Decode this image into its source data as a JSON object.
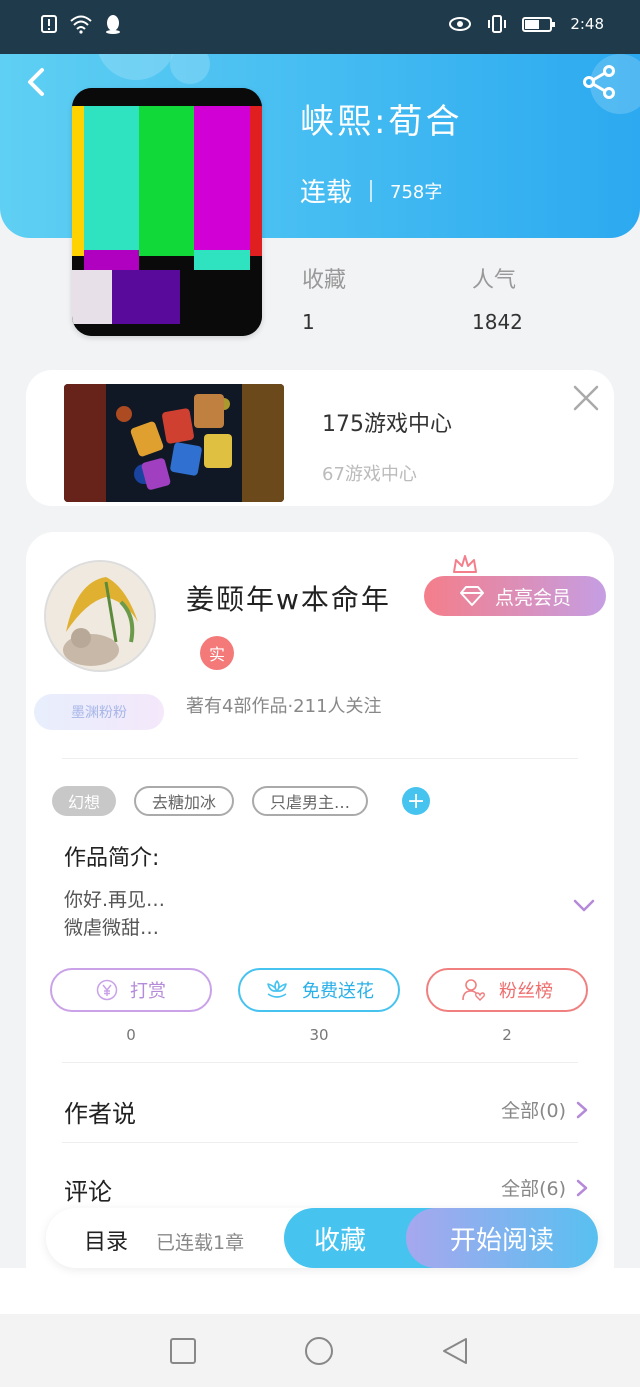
{
  "status_bar": {
    "time": "2:48",
    "icons": [
      "alert-icon",
      "wifi-icon",
      "qq-icon",
      "eye-icon",
      "vibrate-icon",
      "battery-icon"
    ]
  },
  "header": {
    "title": "峡熙:荀合",
    "status": "连载",
    "word_count": "758字",
    "bg_colors": [
      "#5fd0f3",
      "#2ca9f0"
    ]
  },
  "stats": {
    "favorites_label": "收藏",
    "favorites_value": "1",
    "popularity_label": "人气",
    "popularity_value": "1842"
  },
  "ad": {
    "title": "175游戏中心",
    "subtitle": "67游戏中心"
  },
  "author": {
    "name": "姜颐年w本命年",
    "verified_badge": "实",
    "fan_badge": "墨渊粉粉",
    "vip_button": "点亮会员",
    "meta": "著有4部作品·211人关注"
  },
  "tags": [
    {
      "label": "幻想",
      "style": "filled"
    },
    {
      "label": "去糖加冰",
      "style": "outline"
    },
    {
      "label": "只虐男主…",
      "style": "outline"
    }
  ],
  "intro": {
    "label": "作品简介:",
    "line1": "你好.再见…",
    "line2": "微虐微甜…"
  },
  "actions": [
    {
      "label": "打赏",
      "count": "0",
      "color": "#b58ad9"
    },
    {
      "label": "免费送花",
      "count": "30",
      "color": "#2ab0e8"
    },
    {
      "label": "粉丝榜",
      "count": "2",
      "color": "#ee6e6e"
    }
  ],
  "rows": {
    "author_says": {
      "title": "作者说",
      "link": "全部(0)"
    },
    "comments": {
      "title": "评论",
      "link": "全部(6)"
    }
  },
  "bottom_bar": {
    "toc": "目录",
    "progress": "已连载1章",
    "favorite": "收藏",
    "start_reading": "开始阅读"
  }
}
